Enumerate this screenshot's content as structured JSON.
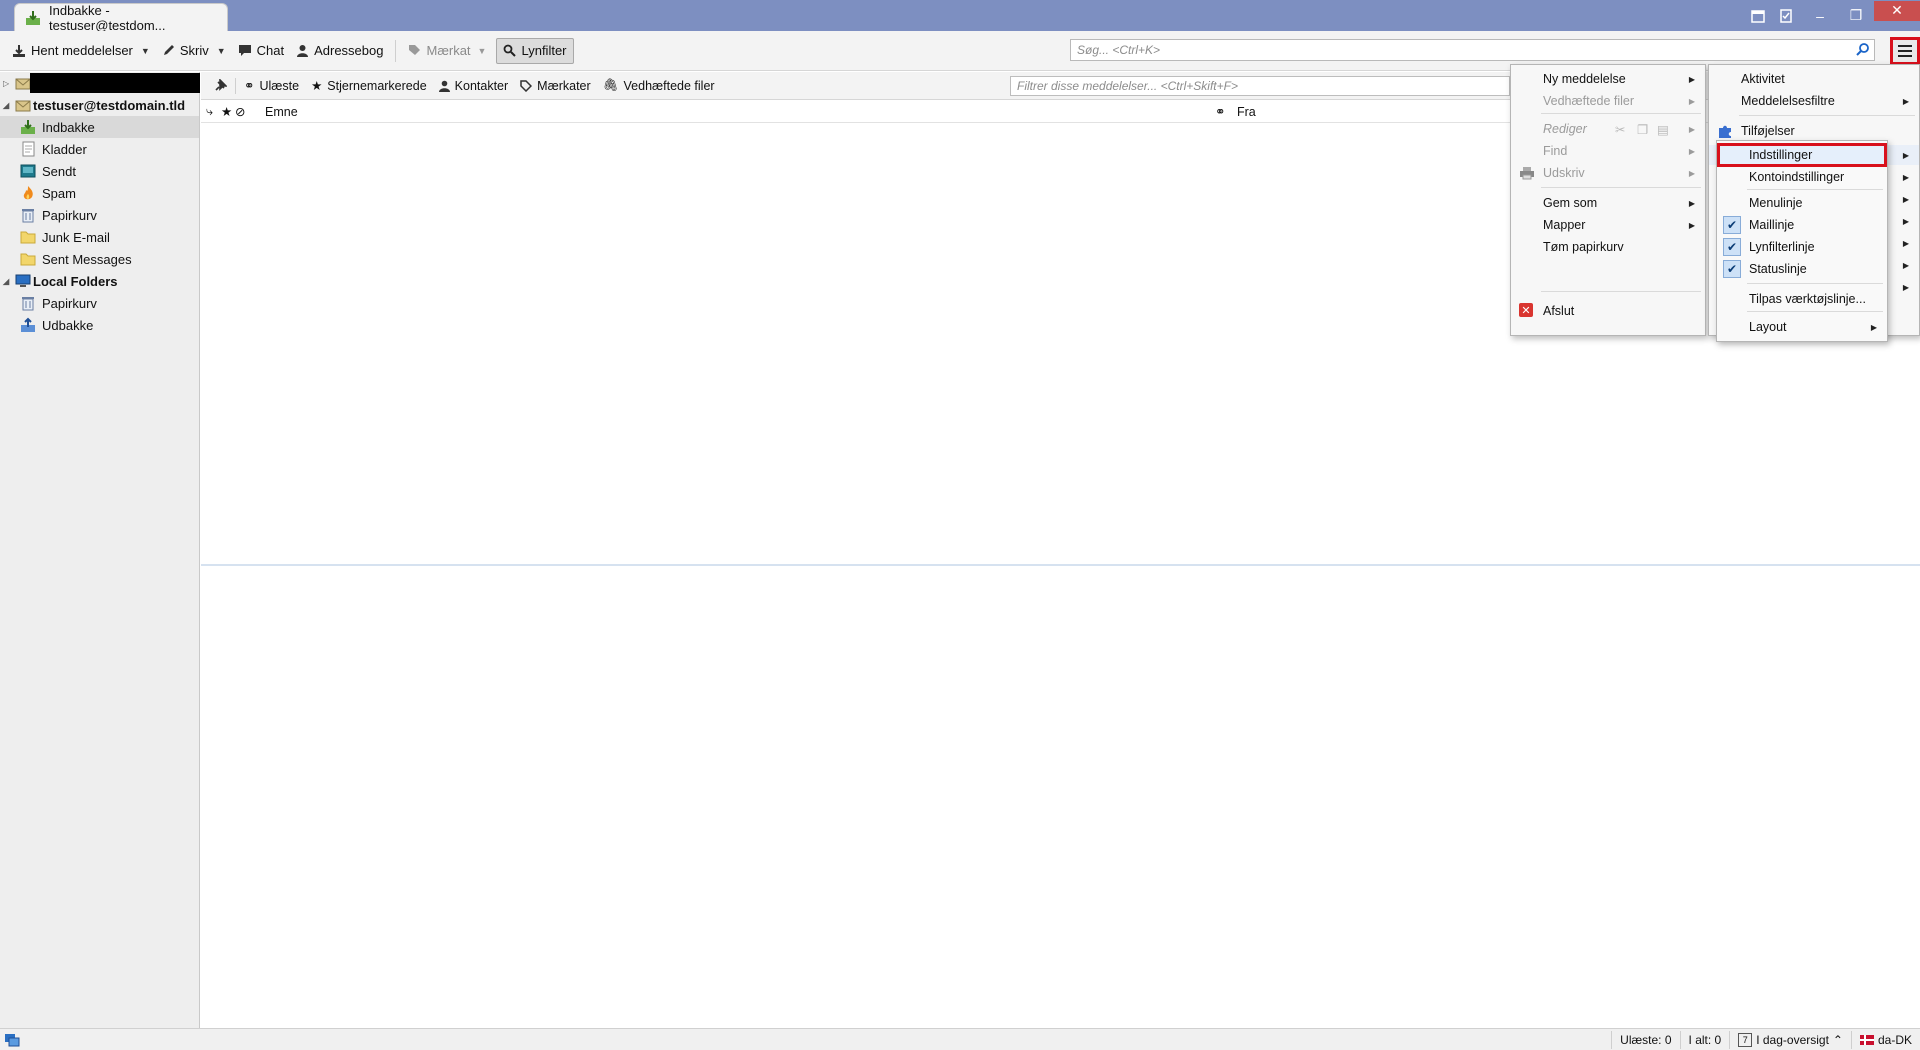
{
  "window": {
    "tab_title": "Indbakke - testuser@testdom...",
    "controls": {
      "minimize": "–",
      "restore": "❐",
      "close": "✕"
    }
  },
  "toolbar": {
    "get_messages": "Hent meddelelser",
    "write": "Skriv",
    "chat": "Chat",
    "address_book": "Adressebog",
    "tag": "Mærkat",
    "quick_filter": "Lynfilter",
    "search_placeholder": "Søg... <Ctrl+K>"
  },
  "folders": {
    "account": "testuser@testdomain.tld",
    "items": [
      {
        "label": "Indbakke",
        "icon": "inbox-icon",
        "selected": true
      },
      {
        "label": "Kladder",
        "icon": "drafts-icon"
      },
      {
        "label": "Sendt",
        "icon": "sent-icon"
      },
      {
        "label": "Spam",
        "icon": "spam-icon"
      },
      {
        "label": "Papirkurv",
        "icon": "trash-icon"
      },
      {
        "label": "Junk E-mail",
        "icon": "folder-icon"
      },
      {
        "label": "Sent Messages",
        "icon": "folder-icon"
      }
    ],
    "local_folders": "Local Folders",
    "local_items": [
      {
        "label": "Papirkurv",
        "icon": "trash-icon"
      },
      {
        "label": "Udbakke",
        "icon": "outbox-icon"
      }
    ]
  },
  "quickfilter": {
    "unread": "Ulæste",
    "starred": "Stjernemarkerede",
    "contacts": "Kontakter",
    "tags": "Mærkater",
    "attachments": "Vedhæftede filer",
    "filter_placeholder": "Filtrer disse meddelelser... <Ctrl+Skift+F>"
  },
  "thread_header": {
    "subject": "Emne",
    "from": "Fra"
  },
  "statusbar": {
    "unread": "Ulæste: 0",
    "total": "I alt: 0",
    "today": "I dag-oversigt",
    "locale": "da-DK"
  },
  "menu_left": {
    "new_message": "Ny meddelelse",
    "attachments": "Vedhæftede filer",
    "edit": "Rediger",
    "find": "Find",
    "print": "Udskriv",
    "save_as": "Gem som",
    "folders": "Mapper",
    "empty_trash": "Tøm papirkurv",
    "quit": "Afslut"
  },
  "menu_right": {
    "activity": "Aktivitet",
    "message_filters": "Meddelelsesfiltre",
    "addons": "Tilføjelser"
  },
  "menu_options": {
    "settings": "Indstillinger",
    "account_settings": "Kontoindstillinger",
    "menubar": "Menulinje",
    "mail_toolbar": "Maillinje",
    "quickfilter_bar": "Lynfilterlinje",
    "status_bar": "Statuslinje",
    "customize": "Tilpas værktøjslinje...",
    "layout": "Layout"
  }
}
